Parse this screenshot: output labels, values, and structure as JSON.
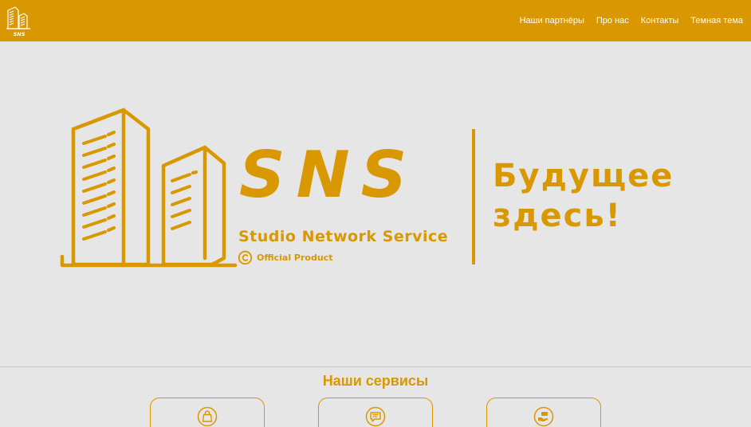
{
  "colors": {
    "accent": "#d99700",
    "background": "#e6e6e6",
    "nav_text": "#ffffff"
  },
  "navbar": {
    "logo_icon": "buildings-logo-icon",
    "logo_text": "SNS",
    "links": [
      {
        "label": "Наши партнёры"
      },
      {
        "label": "Про нас"
      },
      {
        "label": "Контакты"
      },
      {
        "label": "Темная тема"
      }
    ]
  },
  "hero": {
    "logo_icon": "buildings-logo-icon",
    "brand": "SNS",
    "brand_subtitle": "Studio Network Service",
    "copyright_icon": "copyright-icon",
    "official": "Official Product",
    "tagline_line1": "Будущее",
    "tagline_line2": "здесь!"
  },
  "services": {
    "title": "Наши сервисы",
    "cards": [
      {
        "icon": "shopping-bag-icon"
      },
      {
        "icon": "chat-message-icon"
      },
      {
        "icon": "hand-money-icon"
      }
    ]
  }
}
